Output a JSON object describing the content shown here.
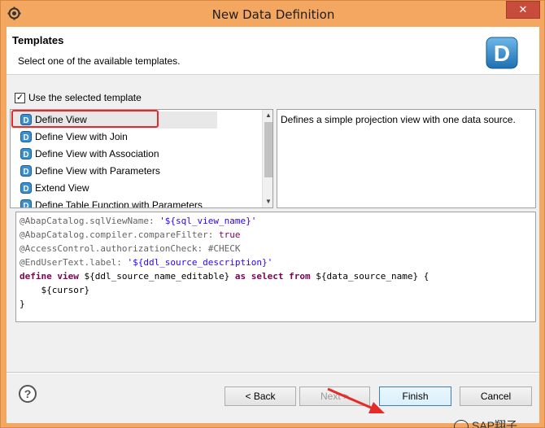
{
  "window": {
    "title": "New Data Definition",
    "close_glyph": "✕"
  },
  "header": {
    "title": "Templates",
    "description": "Select one of the available templates.",
    "logo_letter": "D"
  },
  "use_template": {
    "label": "Use the selected template",
    "checked": true,
    "check_glyph": "✓"
  },
  "templates": {
    "items": [
      {
        "label": "Define View",
        "selected": true
      },
      {
        "label": "Define View with Join",
        "selected": false
      },
      {
        "label": "Define View with Association",
        "selected": false
      },
      {
        "label": "Define View with Parameters",
        "selected": false
      },
      {
        "label": "Extend View",
        "selected": false
      },
      {
        "label": "Define Table Function with Parameters",
        "selected": false
      }
    ],
    "scroll_up_glyph": "▲",
    "scroll_down_glyph": "▼"
  },
  "description": "Defines a simple projection view with one data source.",
  "code": {
    "line1_ann": "@AbapCatalog.sqlViewName: ",
    "line1_str": "'${sql_view_name}'",
    "line2_ann": "@AbapCatalog.compiler.compareFilter: ",
    "line2_kw": "true",
    "line3_ann": "@AccessControl.authorizationCheck: ",
    "line3_val": "#CHECK",
    "line4_ann": "@EndUserText.label: ",
    "line4_str": "'${ddl_source_description}'",
    "line5_kw1": "define view ",
    "line5_var1": "${ddl_source_name_editable} ",
    "line5_kw2": "as select from ",
    "line5_var2": "${data_source_name} {",
    "line6": "    ${cursor}",
    "line7": "}"
  },
  "buttons": {
    "help": "?",
    "back": "< Back",
    "next": "Next >",
    "finish": "Finish",
    "cancel": "Cancel"
  },
  "watermark": "SAP翔子",
  "colors": {
    "window_frame": "#f3a760",
    "annotation": "#e52a2a",
    "keyword": "#7f0055",
    "string": "#2a00ff"
  }
}
